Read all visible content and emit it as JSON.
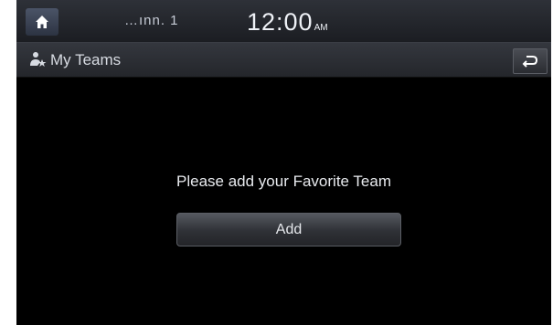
{
  "status_bar": {
    "home_icon": "home-icon",
    "signal_text": "…ınn. 1",
    "time": "12:00",
    "ampm": "AM"
  },
  "title_bar": {
    "icon": "my-teams-icon",
    "title": "My Teams",
    "back_icon": "back-arrow-icon"
  },
  "content": {
    "message": "Please add your Favorite Team",
    "add_label": "Add"
  },
  "colors": {
    "background": "#000000",
    "home_button": "#3b4456",
    "bar": "#2a2c31"
  }
}
